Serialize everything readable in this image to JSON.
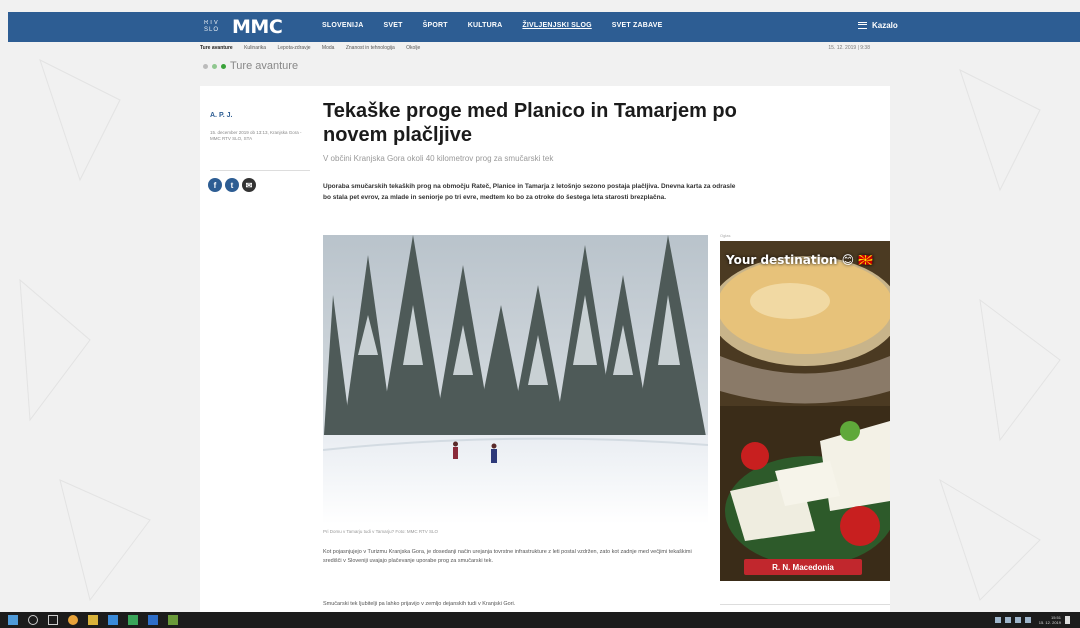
{
  "header": {
    "logo_small": "RTV SLO",
    "logo": "MMC",
    "nav": [
      "SLOVENIJA",
      "SVET",
      "ŠPORT",
      "KULTURA",
      "ŽIVLJENJSKI SLOG",
      "SVET ZABAVE"
    ],
    "active_nav": "ŽIVLJENJSKI SLOG",
    "menu_label": "Kazalo"
  },
  "subnav": {
    "items": [
      "Ture avanture",
      "Kulinarika",
      "Lepota-zdravje",
      "Moda",
      "Znanost in tehnologija",
      "Okolje"
    ],
    "date": "15. 12. 2019 | 9:38"
  },
  "section": {
    "label": "Ture avanture"
  },
  "article": {
    "author": "A. P. J.",
    "meta": "15. december 2019 ob 13:13, Kranjska Gora - MMC RTV SLO, STA",
    "title": "Tekaške proge med Planico in Tamarjem po novem plačljive",
    "subtitle": "V občini Kranjska Gora okoli 40 kilometrov prog za smučarski tek",
    "lead": "Uporaba smučarskih tekaških prog na območju Rateč, Planice in Tamarja z letošnjo sezono postaja plačljiva. Dnevna karta za odrasle bo stala pet evrov, za mlade in seniorje po tri evre, medtem ko bo za otroke do šestega leta starosti brezplačna.",
    "caption": "Pri Domu v Tamarju tudi v Tamarju? Foto: MMC RTV SLO",
    "body1": "Kot pojasnjujejo v Turizmu Kranjska Gora, je dosedanji način urejanja tovrstne infrastrukture z leti postal vzdržen, zato kot zadnje med večjimi tekaškimi središči v Sloveniji uvajajo plačevanje uporabe prog za smučarski tek.",
    "body2": "Smučarski tek ljubitelji pa lahko prijavijo v zemljo dejanskih tudi v Kranjski Gori."
  },
  "share": {
    "icons": [
      "facebook-icon",
      "twitter-icon",
      "email-icon"
    ]
  },
  "ad": {
    "label": "Oglas",
    "headline": "Your destination 😊 🇲🇰",
    "button": "R. N. Macedonia"
  },
  "taskbar": {
    "clock_time": "15:51",
    "clock_date": "15. 12. 2019"
  },
  "colors": {
    "brand": "#2d5d93",
    "ad_button": "#c1272d"
  }
}
